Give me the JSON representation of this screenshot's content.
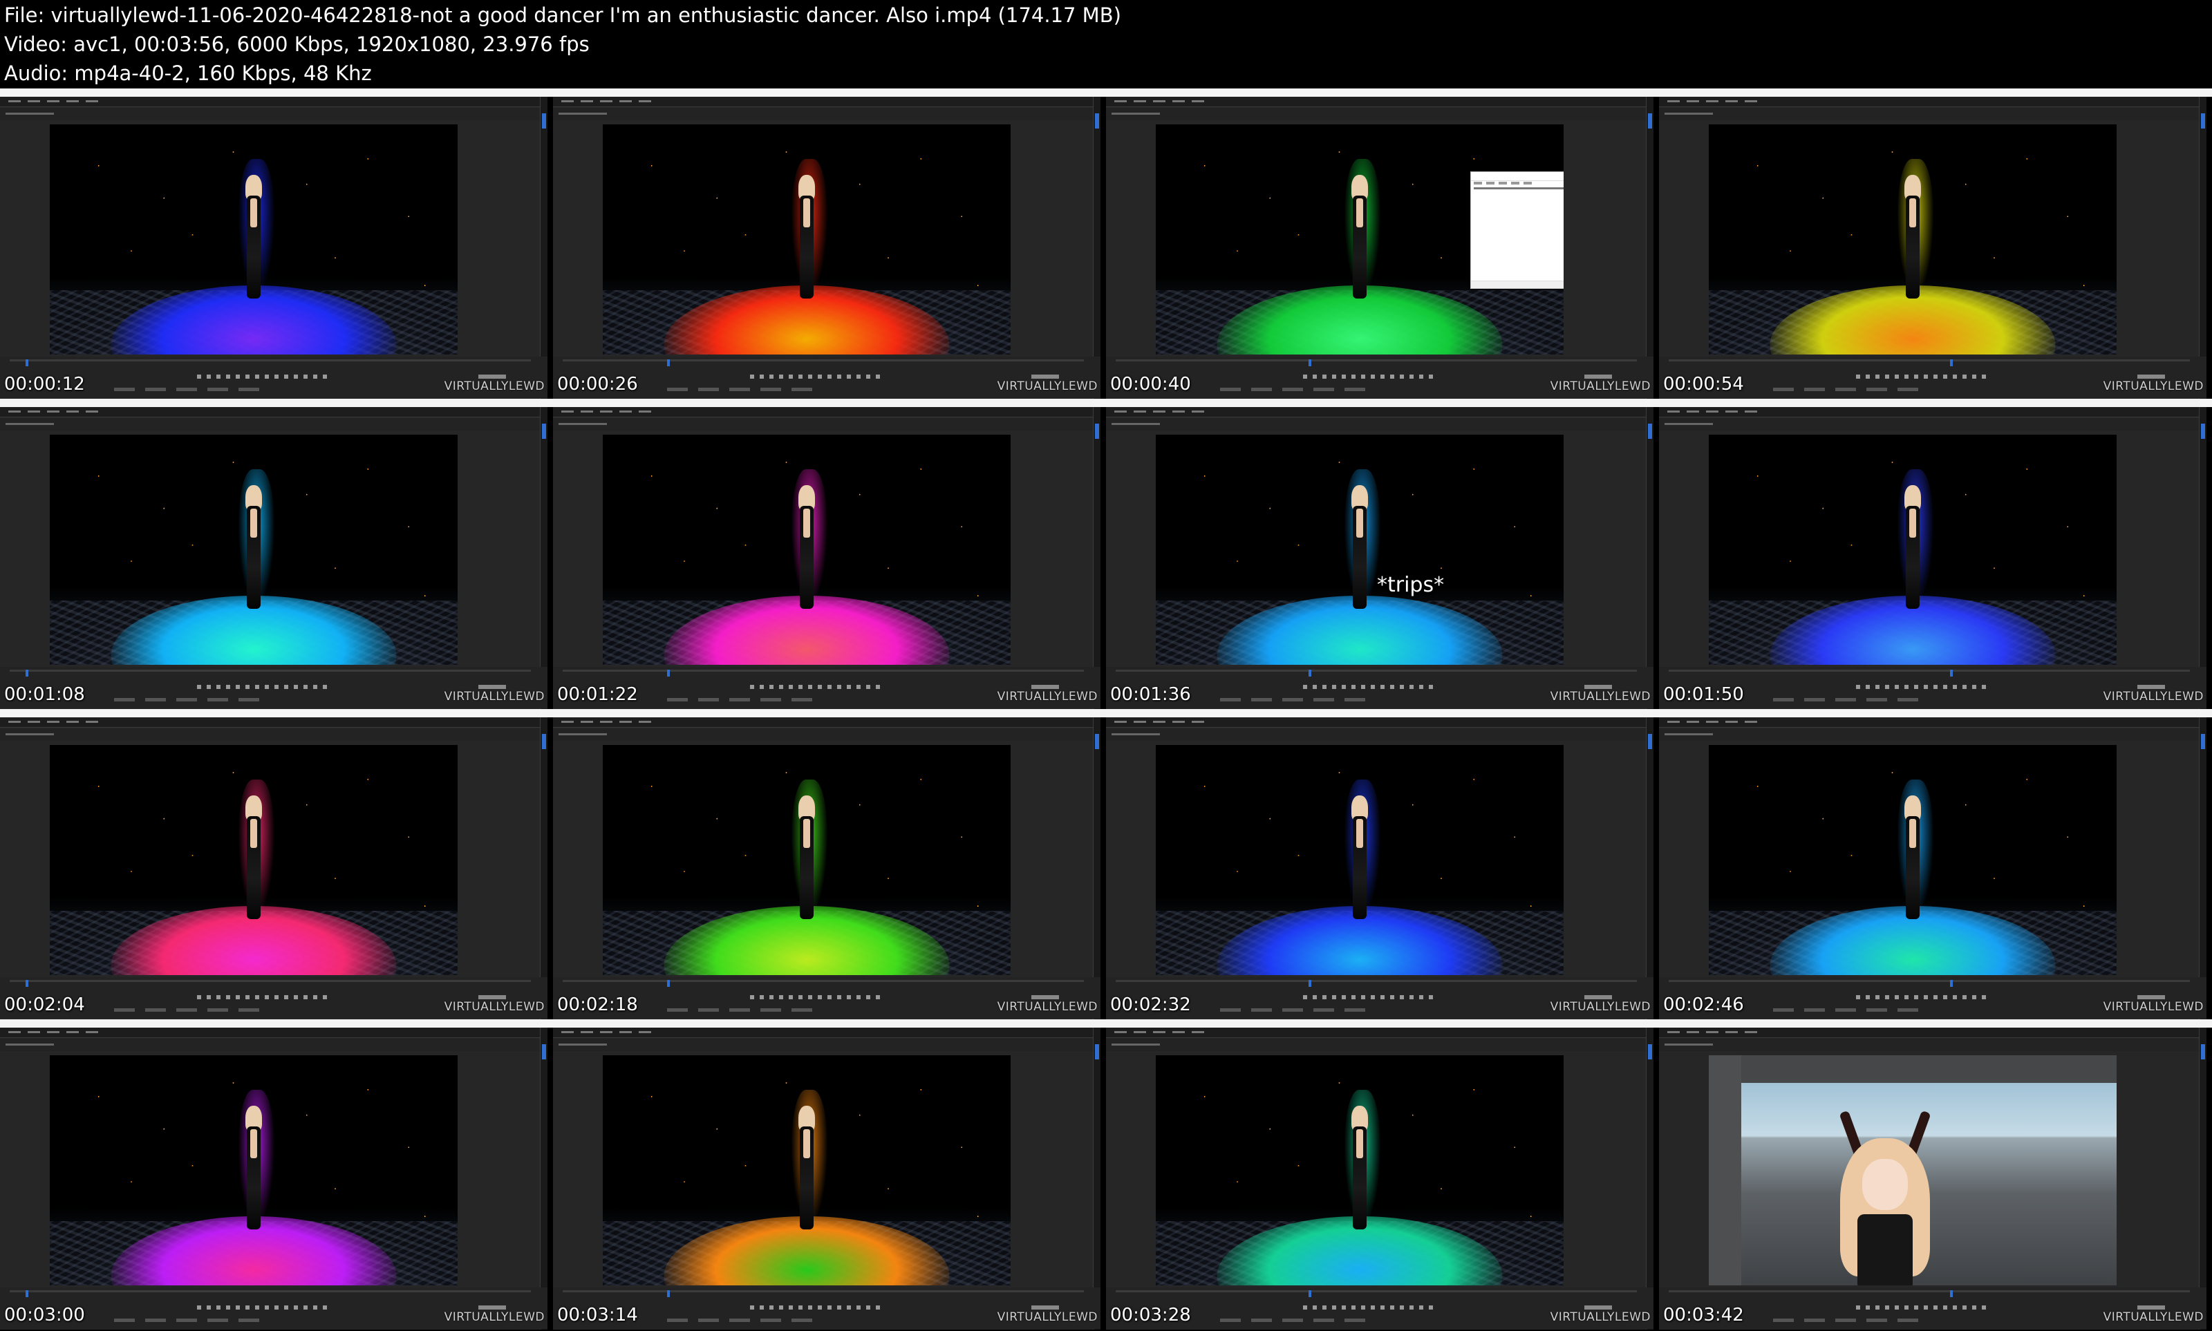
{
  "header": {
    "file_line": "File: virtuallylewd-11-06-2020-46422818-not a good dancer I'm an enthusiastic dancer. Also i.mp4 (174.17 MB)",
    "video_line": "Video: avc1, 00:03:56, 6000 Kbps, 1920x1080, 23.976 fps",
    "audio_line": "Audio: mp4a-40-2, 160 Kbps, 48 Khz"
  },
  "watermark": "VIRTUALLYLEWD",
  "overlay_text": "*trips*",
  "thumbnails": [
    {
      "timecode": "00:00:12",
      "color": "#1f2dff",
      "color2": "#7a2bff"
    },
    {
      "timecode": "00:00:26",
      "color": "#ff2a10",
      "color2": "#ffb400"
    },
    {
      "timecode": "00:00:40",
      "color": "#12d23a",
      "color2": "#36ff78"
    },
    {
      "timecode": "00:00:54",
      "color": "#d8d80d",
      "color2": "#ff8a10"
    },
    {
      "timecode": "00:01:08",
      "color": "#11b8ff",
      "color2": "#23ffd6"
    },
    {
      "timecode": "00:01:22",
      "color": "#ff1ed0",
      "color2": "#ff5a6e"
    },
    {
      "timecode": "00:01:36",
      "color": "#15a7ff",
      "color2": "#1ff2d0"
    },
    {
      "timecode": "00:01:50",
      "color": "#2b3cff",
      "color2": "#3aa0ff"
    },
    {
      "timecode": "00:02:04",
      "color": "#ff2a74",
      "color2": "#ff2ad7"
    },
    {
      "timecode": "00:02:18",
      "color": "#42e61b",
      "color2": "#c3f51e"
    },
    {
      "timecode": "00:02:32",
      "color": "#1f3dff",
      "color2": "#1bb7ff"
    },
    {
      "timecode": "00:02:46",
      "color": "#18a8ff",
      "color2": "#1ff0b0"
    },
    {
      "timecode": "00:03:00",
      "color": "#c41eff",
      "color2": "#ff2aa8"
    },
    {
      "timecode": "00:03:14",
      "color": "#ff8a10",
      "color2": "#2ad11a"
    },
    {
      "timecode": "00:03:28",
      "color": "#14d89a",
      "color2": "#1ab6ff"
    },
    {
      "timecode": "00:03:42",
      "color": "#8fb6cf",
      "color2": "#8fb6cf"
    }
  ]
}
